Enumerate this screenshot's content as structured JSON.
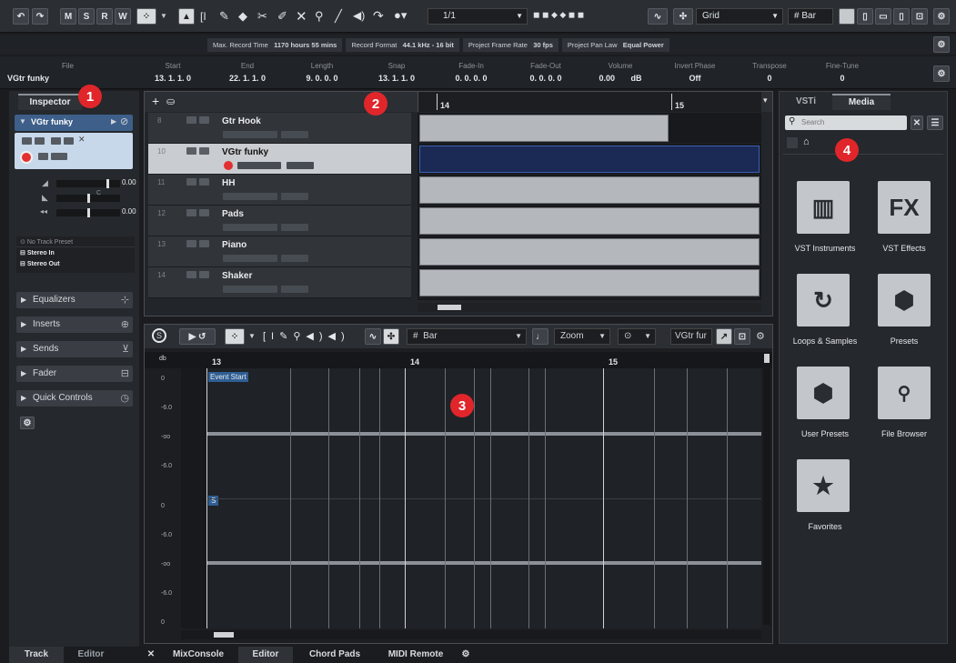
{
  "toolbar": {
    "undo": "↶",
    "redo": "↷",
    "m": "M",
    "s": "S",
    "r": "R",
    "w": "W",
    "position": "1/1",
    "grid_label": "Grid",
    "bar_label": "Bar"
  },
  "status": {
    "max_record_label": "Max. Record Time",
    "max_record_value": "1170 hours 55 mins",
    "record_format_label": "Record Format",
    "record_format_value": "44.1 kHz - 16 bit",
    "frame_rate_label": "Project Frame Rate",
    "frame_rate_value": "30 fps",
    "pan_law_label": "Project Pan Law",
    "pan_law_value": "Equal Power"
  },
  "infoline": {
    "file_label": "File",
    "file_value": "VGtr funky",
    "start_label": "Start",
    "start_value": "13. 1. 1.   0",
    "end_label": "End",
    "end_value": "22. 1. 1.   0",
    "length_label": "Length",
    "length_value": "9. 0. 0.   0",
    "snap_label": "Snap",
    "snap_value": "13. 1. 1.   0",
    "fadein_label": "Fade-In",
    "fadein_value": "0. 0. 0.   0",
    "fadeout_label": "Fade-Out",
    "fadeout_value": "0. 0. 0.   0",
    "volume_label": "Volume",
    "volume_value": "0.00",
    "volume_unit": "dB",
    "invert_label": "Invert Phase",
    "invert_value": "Off",
    "transpose_label": "Transpose",
    "transpose_value": "0",
    "finetune_label": "Fine-Tune",
    "finetune_value": "0"
  },
  "inspector": {
    "tab": "Inspector",
    "track_name": "VGtr funky",
    "fader_value": "0.00",
    "pan_value": "C",
    "third_value": "0.00",
    "preset": "No Track Preset",
    "input": "Stereo In",
    "output": "Stereo Out",
    "sections": [
      "Equalizers",
      "Inserts",
      "Sends",
      "Fader",
      "Quick Controls"
    ]
  },
  "tracks": [
    {
      "num": "8",
      "name": "Gtr Hook"
    },
    {
      "num": "10",
      "name": "VGtr funky"
    },
    {
      "num": "11",
      "name": "HH"
    },
    {
      "num": "12",
      "name": "Pads"
    },
    {
      "num": "13",
      "name": "Piano"
    },
    {
      "num": "14",
      "name": "Shaker"
    }
  ],
  "ruler": {
    "m14": "14",
    "m15": "15"
  },
  "editor": {
    "bar_label": "Bar",
    "zoom_label": "Zoom",
    "track_label": "VGtr fur",
    "m13": "13",
    "m14": "14",
    "m15": "15",
    "event_start": "Event Start",
    "s_marker": "S",
    "db_label": "db",
    "y_labels": [
      "0",
      "-6.0",
      "-oo",
      "-6.0",
      "0",
      "-6.0",
      "-oo",
      "-6.0",
      "0"
    ]
  },
  "media": {
    "tab_vsti": "VSTi",
    "tab_media": "Media",
    "search_placeholder": "Search",
    "tiles": [
      {
        "label": "VST Instruments",
        "icon": "piano-keys-icon"
      },
      {
        "label": "VST Effects",
        "icon": "fx-icon"
      },
      {
        "label": "Loops & Samples",
        "icon": "loop-icon"
      },
      {
        "label": "Presets",
        "icon": "hexagons-icon"
      },
      {
        "label": "User Presets",
        "icon": "user-preset-icon"
      },
      {
        "label": "File Browser",
        "icon": "file-browser-icon"
      },
      {
        "label": "Favorites",
        "icon": "star-icon"
      }
    ]
  },
  "bottom": {
    "track": "Track",
    "editor": "Editor",
    "close": "✕",
    "mixconsole": "MixConsole",
    "editor2": "Editor",
    "chordpads": "Chord Pads",
    "midiremote": "MIDI Remote"
  },
  "callouts": [
    "1",
    "2",
    "3",
    "4"
  ]
}
